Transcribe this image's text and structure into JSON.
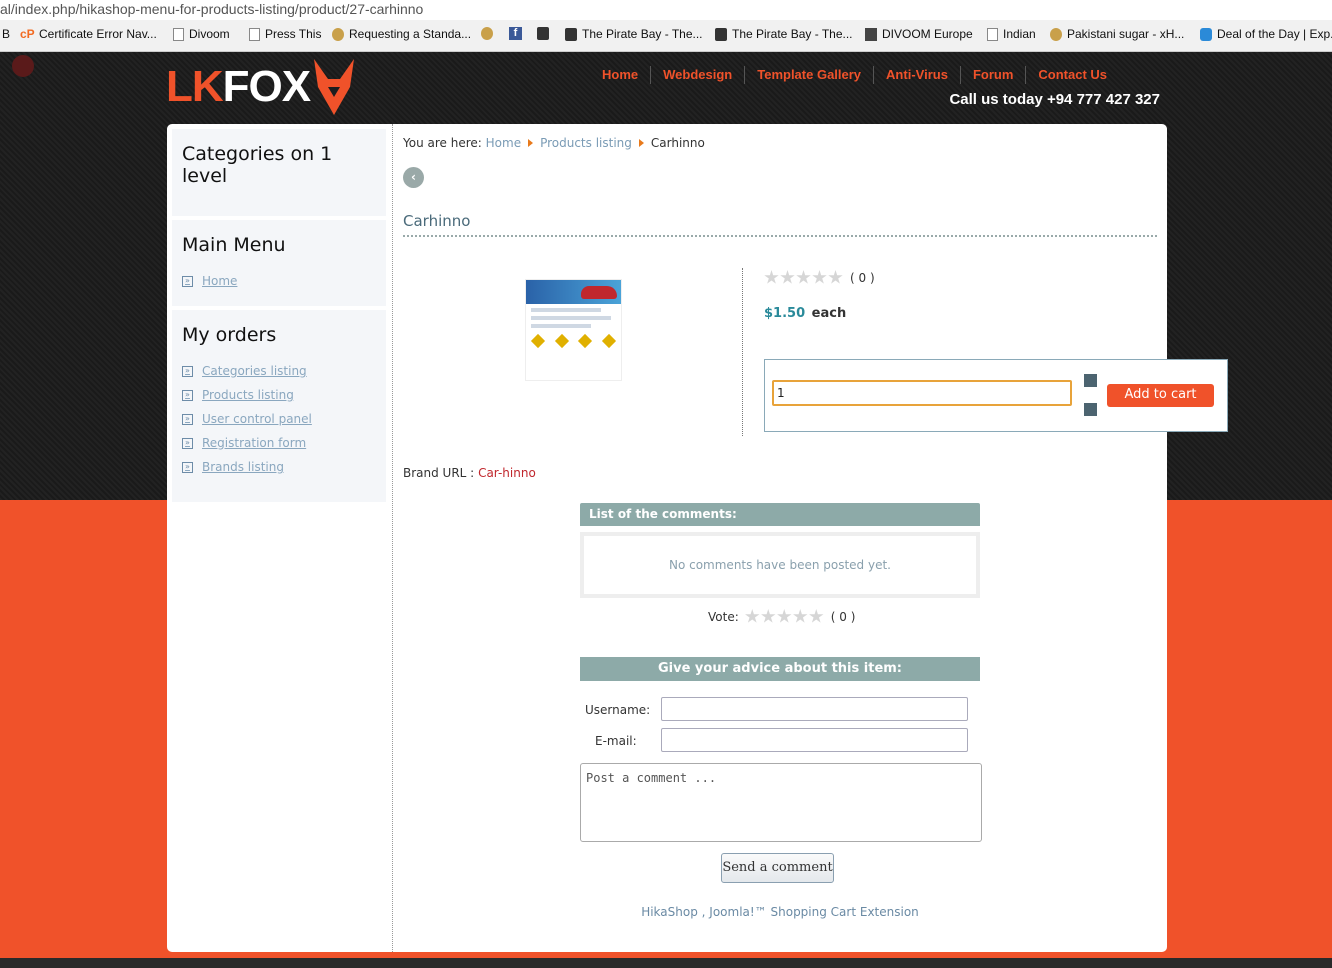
{
  "browser": {
    "url": "al/index.php/hikashop-menu-for-products-listing/product/27-carhinno",
    "bookmarks": [
      {
        "label": "B",
        "icon": "none-icon"
      },
      {
        "label": "Certificate Error Nav...",
        "icon": "cpanel-icon"
      },
      {
        "label": "Divoom",
        "icon": "page-icon"
      },
      {
        "label": "Press This",
        "icon": "page-icon"
      },
      {
        "label": "Requesting a Standa...",
        "icon": "generic-icon"
      },
      {
        "label": "",
        "icon": "generic-icon"
      },
      {
        "label": "",
        "icon": "facebook-icon"
      },
      {
        "label": "",
        "icon": "pirate-icon"
      },
      {
        "label": "The Pirate Bay - The...",
        "icon": "pirate-icon"
      },
      {
        "label": "The Pirate Bay - The...",
        "icon": "pirate-icon"
      },
      {
        "label": "DIVOOM Europe",
        "icon": "divoom-icon"
      },
      {
        "label": "Indian",
        "icon": "page-icon"
      },
      {
        "label": "Pakistani sugar - xH...",
        "icon": "generic-icon"
      },
      {
        "label": "Deal of the Day | Exp...",
        "icon": "blue-icon"
      }
    ]
  },
  "site": {
    "logo_a": "LK",
    "logo_b": "FOX",
    "nav": [
      "Home",
      "Webdesign",
      "Template Gallery",
      "Anti-Virus",
      "Forum",
      "Contact Us"
    ],
    "callus": "Call us today +94 777 427 327",
    "accent": "#f0522a"
  },
  "sidebar": {
    "categories_title": "Categories on 1 level",
    "main_menu_title": "Main Menu",
    "main_menu_items": [
      "Home"
    ],
    "orders_title": "My orders",
    "orders_items": [
      "Categories listing",
      "Products listing",
      "User control panel",
      "Registration form",
      "Brands listing"
    ]
  },
  "breadcrumb": {
    "prefix": "You are here:",
    "items": [
      "Home",
      "Products listing",
      "Carhinno"
    ]
  },
  "product": {
    "back_icon": "back-arrow-icon",
    "title": "Carhinno",
    "rating_count": "( 0 )",
    "price": "$1.50",
    "price_unit": "each",
    "quantity": "1",
    "add_to_cart": "Add to cart",
    "brand_label": "Brand URL :",
    "brand_value": "Car-hinno"
  },
  "comments": {
    "list_title": "List of the comments:",
    "empty_text": "No comments have been posted yet.",
    "vote_label": "Vote:",
    "vote_count": "( 0 )",
    "advice_title": "Give your advice about this item:",
    "username_label": "Username:",
    "username_value": "",
    "email_label": "E-mail:",
    "email_value": "",
    "comment_placeholder": "Post a comment ...",
    "send_label": "Send a comment"
  },
  "footer": {
    "text": "HikaShop , Joomla!™ Shopping Cart Extension"
  }
}
